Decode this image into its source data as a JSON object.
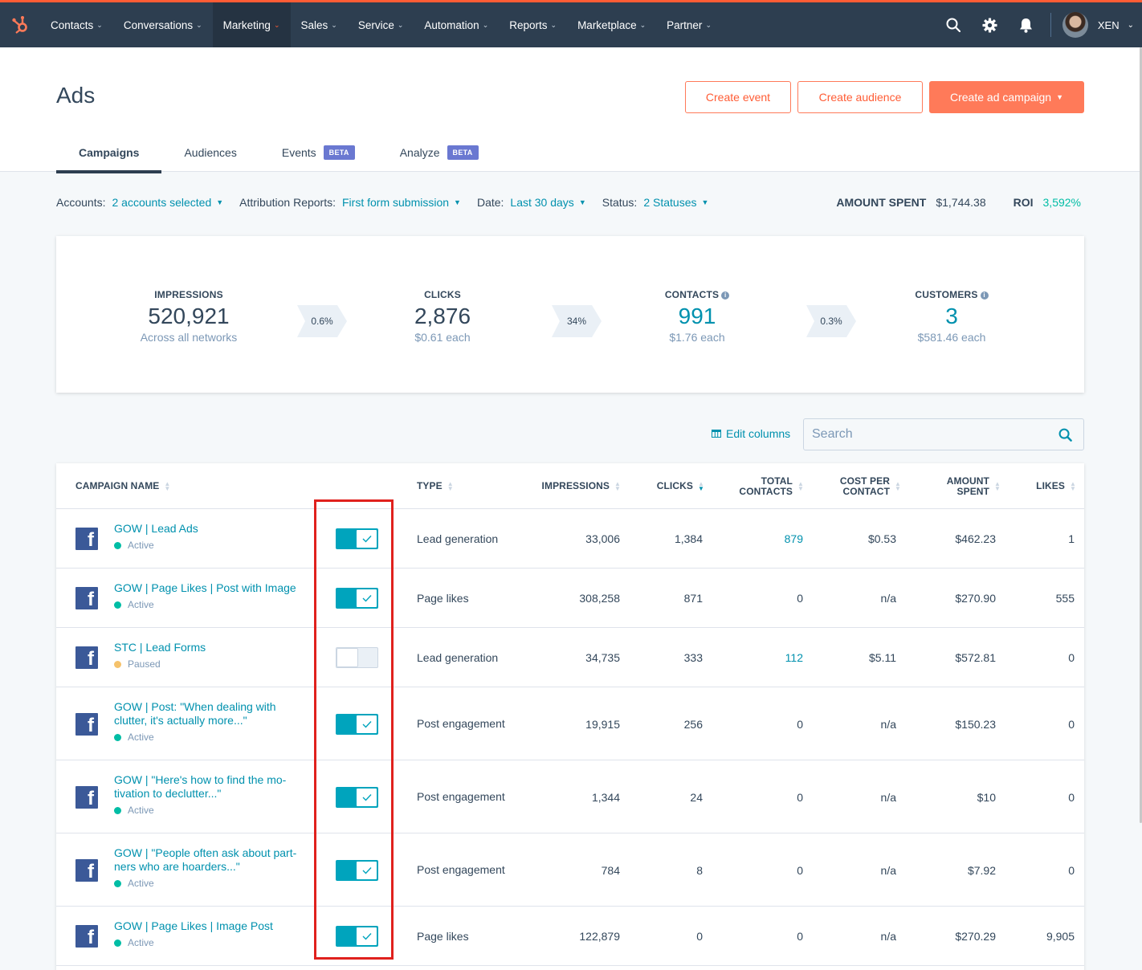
{
  "nav": {
    "items": [
      {
        "label": "Contacts",
        "active": false
      },
      {
        "label": "Conversations",
        "active": false
      },
      {
        "label": "Marketing",
        "active": true
      },
      {
        "label": "Sales",
        "active": false
      },
      {
        "label": "Service",
        "active": false
      },
      {
        "label": "Automation",
        "active": false
      },
      {
        "label": "Reports",
        "active": false
      },
      {
        "label": "Marketplace",
        "active": false
      },
      {
        "label": "Partner",
        "active": false
      }
    ],
    "user": "XEN",
    "icons": [
      "sprocket-logo-icon",
      "search-icon",
      "gear-icon",
      "bell-icon",
      "avatar"
    ]
  },
  "header": {
    "title": "Ads",
    "buttons": {
      "create_event": "Create event",
      "create_audience": "Create audience",
      "create_campaign": "Create ad campaign"
    },
    "tabs": [
      {
        "label": "Campaigns",
        "badge": "",
        "active": true
      },
      {
        "label": "Audiences",
        "badge": "",
        "active": false
      },
      {
        "label": "Events",
        "badge": "BETA",
        "active": false
      },
      {
        "label": "Analyze",
        "badge": "BETA",
        "active": false
      }
    ]
  },
  "filters": {
    "accounts_label": "Accounts:",
    "accounts_value": "2 accounts selected",
    "attribution_label": "Attribution Reports:",
    "attribution_value": "First form submission",
    "date_label": "Date:",
    "date_value": "Last 30 days",
    "status_label": "Status:",
    "status_value": "2 Statuses"
  },
  "totals": {
    "amount_label": "AMOUNT SPENT",
    "amount_value": "$1,744.38",
    "roi_label": "ROI",
    "roi_value": "3,592%"
  },
  "funnel": {
    "impressions": {
      "label": "IMPRESSIONS",
      "value": "520,921",
      "sub": "Across all networks"
    },
    "rate1": "0.6%",
    "clicks": {
      "label": "CLICKS",
      "value": "2,876",
      "sub": "$0.61 each"
    },
    "rate2": "34%",
    "contacts": {
      "label": "CONTACTS",
      "value": "991",
      "sub": "$1.76 each"
    },
    "rate3": "0.3%",
    "customers": {
      "label": "CUSTOMERS",
      "value": "3",
      "sub": "$581.46 each"
    }
  },
  "toolbar": {
    "edit_columns": "Edit columns",
    "search_placeholder": "Search"
  },
  "table": {
    "headers": {
      "name": "CAMPAIGN NAME",
      "type": "TYPE",
      "impressions": "IMPRESSIONS",
      "clicks": "CLICKS",
      "contacts_1": "TOTAL",
      "contacts_2": "CONTACTS",
      "cpc_1": "COST PER",
      "cpc_2": "CONTACT",
      "spent_1": "AMOUNT",
      "spent_2": "SPENT",
      "likes": "LIKES"
    },
    "rows": [
      {
        "name": "GOW | Lead Ads",
        "status": "Active",
        "on": true,
        "type": "Lead generation",
        "impressions": "33,006",
        "clicks": "1,384",
        "contacts": "879",
        "cpc": "$0.53",
        "spent": "$462.23",
        "likes": "1"
      },
      {
        "name": "GOW | Page Likes | Post with Image",
        "status": "Active",
        "on": true,
        "type": "Page likes",
        "impressions": "308,258",
        "clicks": "871",
        "contacts": "0",
        "cpc": "n/a",
        "spent": "$270.90",
        "likes": "555"
      },
      {
        "name": "STC | Lead Forms",
        "status": "Paused",
        "on": false,
        "type": "Lead generation",
        "impressions": "34,735",
        "clicks": "333",
        "contacts": "112",
        "cpc": "$5.11",
        "spent": "$572.81",
        "likes": "0"
      },
      {
        "name": "GOW | Post: \"When dealing with clutter, it's actually more...\"",
        "status": "Active",
        "on": true,
        "type": "Post engagement",
        "impressions": "19,915",
        "clicks": "256",
        "contacts": "0",
        "cpc": "n/a",
        "spent": "$150.23",
        "likes": "0"
      },
      {
        "name": "GOW | \"Here's how to find the mo-tivation to declutter...\"",
        "status": "Active",
        "on": true,
        "type": "Post engagement",
        "impressions": "1,344",
        "clicks": "24",
        "contacts": "0",
        "cpc": "n/a",
        "spent": "$10",
        "likes": "0"
      },
      {
        "name": "GOW | \"People often ask about part-ners who are hoarders...\"",
        "status": "Active",
        "on": true,
        "type": "Post engagement",
        "impressions": "784",
        "clicks": "8",
        "contacts": "0",
        "cpc": "n/a",
        "spent": "$7.92",
        "likes": "0"
      },
      {
        "name": "GOW | Page Likes | Image Post",
        "status": "Active",
        "on": true,
        "type": "Page likes",
        "impressions": "122,879",
        "clicks": "0",
        "contacts": "0",
        "cpc": "n/a",
        "spent": "$270.29",
        "likes": "9,905"
      }
    ]
  },
  "colors": {
    "nav_bg": "#2d3e50",
    "accent": "#ff7a59",
    "link": "#0091ae",
    "toggle_on": "#00a4bd",
    "highlight": "#e0211d"
  }
}
